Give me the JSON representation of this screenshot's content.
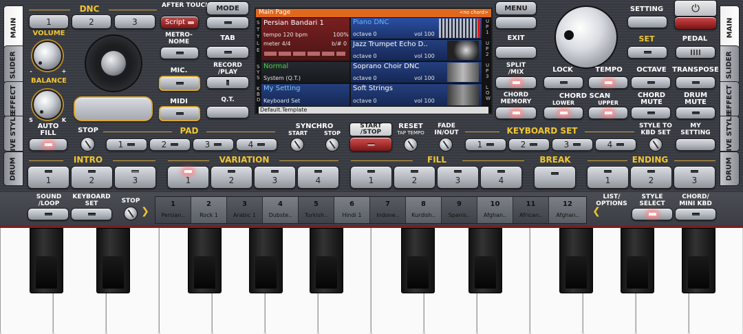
{
  "tabs_left": [
    "MAIN",
    "SLIDER",
    "EFFECT",
    "LIVE STYLE",
    "DRUM"
  ],
  "tabs_right": [
    "MAIN",
    "SLIDER",
    "EFFECT",
    "LIVE STYLE",
    "DRUM"
  ],
  "dnc": {
    "label": "DNC",
    "buttons": [
      "1",
      "2",
      "3"
    ],
    "after_touch": "AFTER TOUCH",
    "script": "Script"
  },
  "volume": "VOLUME",
  "balance": "BALANCE",
  "balance_s": "S",
  "balance_k": "K",
  "metronome": "METRO-\nNOME",
  "mic": "MIC.",
  "midi": "MIDI",
  "mode": "MODE",
  "tab": "TAB",
  "record_play": "RECORD\n/PLAY",
  "qt": "Q.T.",
  "menu": "MENU",
  "exit": "EXIT",
  "split_mix": "SPLIT\n/MIX",
  "chord_memory": "CHORD\nMEMORY",
  "setting": "SETTING",
  "set": "SET",
  "pedal": "PEDAL",
  "display": {
    "header": "Main Page",
    "header_right": "<no chord>",
    "style": {
      "name": "Persian Bandari 1",
      "tempo": "tempo 120 bpm",
      "percent": "100%",
      "meter": "meter 4/4",
      "bnum": "b/# 0"
    },
    "upper1": {
      "name": "Piano DNC",
      "octave": "octave 0",
      "vol": "vol 100"
    },
    "upper2": {
      "name": "Jazz Trumpet Echo D..",
      "octave": "octave 0",
      "vol": "vol 100"
    },
    "upper3": {
      "name": "Soprano Choir DNC",
      "octave": "octave 0",
      "vol": "vol 100"
    },
    "lower": {
      "name": "Soft Strings",
      "octave": "octave 0",
      "vol": "vol 100"
    },
    "sys_title": "Normal",
    "sys_sub": "System (Q.T.)",
    "kbd_title": "My Setting",
    "kbd_sub": "Keyboard Set",
    "footer": "Default.Template",
    "side_left": [
      "S",
      "T",
      "Y",
      "L",
      "E",
      "S",
      "Y",
      "S",
      "K",
      "B",
      "D"
    ],
    "side_right": [
      "U",
      "P",
      "1",
      "U",
      "P",
      "2",
      "U",
      "P",
      "3",
      "L",
      "O",
      "W"
    ]
  },
  "lock": "LOCK",
  "tempo": "TEMPO",
  "octave": "OCTAVE",
  "transpose": "TRANSPOSE",
  "chord_scan": "CHORD SCAN",
  "lower": "LOWER",
  "upper": "UPPER",
  "chord_mute": "CHORD\nMUTE",
  "drum_mute": "DRUM\nMUTE",
  "auto_fill": "AUTO\nFILL",
  "stop": "STOP",
  "pad": {
    "label": "PAD",
    "buttons": [
      "1",
      "2",
      "3",
      "4"
    ]
  },
  "synchro": "SYNCHRO",
  "synchro_start": "START",
  "synchro_stop": "STOP",
  "start_stop": "START\n/STOP",
  "reset": "RESET",
  "tap_tempo": "TAP TEMPO",
  "fade": "FADE\nIN/OUT",
  "keyboard_set": {
    "label": "KEYBOARD SET",
    "buttons": [
      "1",
      "2",
      "3",
      "4"
    ]
  },
  "style_to_kbd": "STYLE TO\nKBD SET",
  "my_setting": "MY\nSETTING",
  "intro": {
    "label": "INTRO",
    "buttons": [
      "1",
      "2",
      "3"
    ]
  },
  "variation": {
    "label": "VARIATION",
    "buttons": [
      "1",
      "2",
      "3",
      "4"
    ]
  },
  "fill": {
    "label": "FILL",
    "buttons": [
      "1",
      "2",
      "3",
      "4"
    ]
  },
  "break": "BREAK",
  "ending": {
    "label": "ENDING",
    "buttons": [
      "1",
      "2",
      "3"
    ]
  },
  "sound_loop": "SOUND\n/LOOP",
  "keyboard_set_btn": "KEYBOARD\nSET",
  "stop2": "STOP",
  "list_options": "LIST/\nOPTIONS",
  "style_select": "STYLE\nSELECT",
  "chord_mini": "CHORD/\nMINI KBD",
  "styles": [
    {
      "n": "1",
      "s": "Persian.."
    },
    {
      "n": "2",
      "s": "Rock 1"
    },
    {
      "n": "3",
      "s": "Arabic 1"
    },
    {
      "n": "4",
      "s": "Dubste.."
    },
    {
      "n": "5",
      "s": "Turkish.."
    },
    {
      "n": "6",
      "s": "Hindi 1"
    },
    {
      "n": "7",
      "s": "Indone.."
    },
    {
      "n": "8",
      "s": "Kurdish.."
    },
    {
      "n": "9",
      "s": "Spanis.."
    },
    {
      "n": "10",
      "s": "Afghan.."
    },
    {
      "n": "11",
      "s": "African.."
    },
    {
      "n": "12",
      "s": "Afghan.."
    }
  ]
}
